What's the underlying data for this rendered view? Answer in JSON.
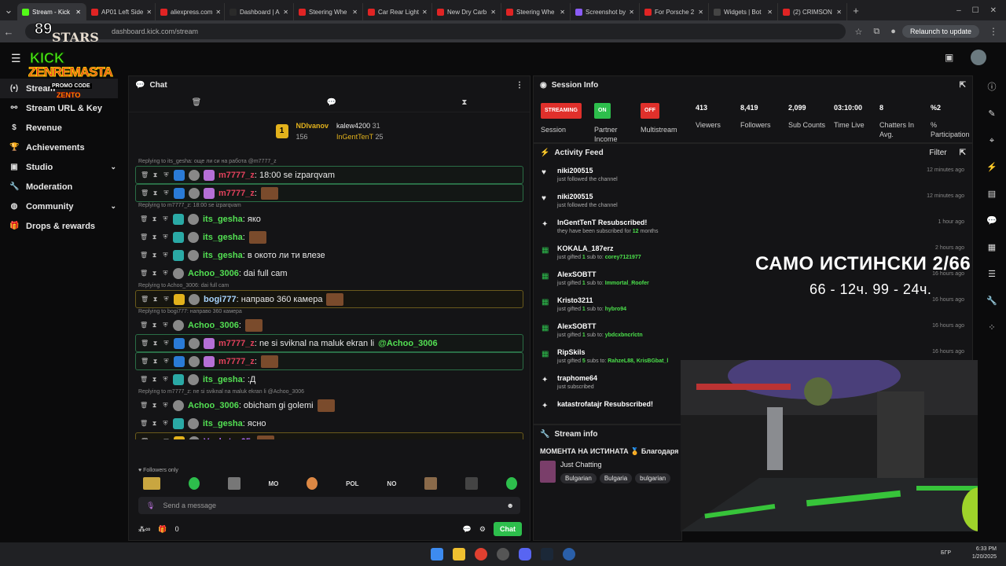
{
  "browser": {
    "tabs": [
      {
        "label": "Stream - Kick",
        "color": "#53fc18",
        "active": true
      },
      {
        "label": "AP01 Left Side",
        "color": "#e02424"
      },
      {
        "label": "aliexpress.com",
        "color": "#e02424"
      },
      {
        "label": "Dashboard | A",
        "color": "#2a2a2a"
      },
      {
        "label": "Steering Whe",
        "color": "#e02424"
      },
      {
        "label": "Car Rear Light",
        "color": "#e02424"
      },
      {
        "label": "New Dry Carb",
        "color": "#e02424"
      },
      {
        "label": "Steering Whe",
        "color": "#e02424"
      },
      {
        "label": "Screenshot by",
        "color": "#8a5cf6"
      },
      {
        "label": "For Porsche 2",
        "color": "#e02424"
      },
      {
        "label": "Widgets | Bot",
        "color": "#444"
      },
      {
        "label": "(2) CRIMSON",
        "color": "#e02424"
      }
    ],
    "url": "dashboard.kick.com/stream",
    "relaunch_label": "Relaunch to update"
  },
  "logo": {
    "line1": "89",
    "line2": "STARS",
    "kick": "KICK",
    "brand": "ZENREMASTA",
    "promo": "PROMO CODE",
    "code": "ZENTO"
  },
  "sidebar": {
    "items": [
      {
        "label": "Stream",
        "icon": "broadcast-icon",
        "glyph": "(•)",
        "active": true
      },
      {
        "label": "Stream URL & Key",
        "icon": "link-icon",
        "glyph": "⚯"
      },
      {
        "label": "Revenue",
        "icon": "dollar-icon",
        "glyph": "$"
      },
      {
        "label": "Achievements",
        "icon": "trophy-icon",
        "glyph": "🏆"
      },
      {
        "label": "Studio",
        "icon": "studio-icon",
        "glyph": "▣",
        "chevron": true
      },
      {
        "label": "Moderation",
        "icon": "wrench-icon",
        "glyph": "🔧"
      },
      {
        "label": "Community",
        "icon": "globe-icon",
        "glyph": "◍",
        "chevron": true
      },
      {
        "label": "Drops & rewards",
        "icon": "gift-icon",
        "glyph": "🎁"
      }
    ]
  },
  "chat": {
    "title": "Chat",
    "pinned": {
      "user1": "NDIvanov",
      "count1": "156",
      "user2": "kalew4200",
      "count2": "31",
      "user3": "InGentTenT",
      "count3": "25"
    },
    "messages": [
      {
        "reply": "Replying to its_gesha: още ли си на работа @m7777_z",
        "user": "m7777_z",
        "color": "#e0415c",
        "text": ": 18:00 se izparqvam",
        "style": "hl",
        "badges": [
          "b-blue",
          "b-avatar",
          "b-purple"
        ]
      },
      {
        "user": "m7777_z",
        "color": "#e0415c",
        "text": ":",
        "style": "hl",
        "badges": [
          "b-blue",
          "b-avatar",
          "b-purple"
        ],
        "emote": true
      },
      {
        "reply": "Replying to m7777_z: 18:00 se izparqvam",
        "user": "its_gesha",
        "color": "#53e053",
        "text": ": яко",
        "badges": [
          "b-teal",
          "b-avatar"
        ]
      },
      {
        "user": "its_gesha",
        "color": "#53e053",
        "text": ":",
        "badges": [
          "b-teal",
          "b-avatar"
        ],
        "emote": true
      },
      {
        "user": "its_gesha",
        "color": "#53e053",
        "text": ": в окото ли ти влезе",
        "badges": [
          "b-teal",
          "b-avatar"
        ]
      },
      {
        "user": "Achoo_3006",
        "color": "#53e053",
        "text": ": dai full cam",
        "badges": [
          "b-avatar"
        ]
      },
      {
        "reply": "Replying to Achoo_3006: dai full cam",
        "user": "bogi777",
        "color": "#a8d4ff",
        "text": ": направо 360 камера",
        "style": "gold",
        "badges": [
          "b-gold",
          "b-avatar"
        ],
        "emote": true
      },
      {
        "reply": "Replying to bogi777: направо 360 камера",
        "user": "Achoo_3006",
        "color": "#53e053",
        "text": ":",
        "badges": [
          "b-avatar"
        ],
        "emote": true
      },
      {
        "user": "m7777_z",
        "color": "#e0415c",
        "text": ": ne si sviknal na maluk ekran li",
        "mention": "@Achoo_3006",
        "style": "hl",
        "badges": [
          "b-blue",
          "b-avatar",
          "b-purple"
        ]
      },
      {
        "user": "m7777_z",
        "color": "#e0415c",
        "text": ":",
        "style": "hl",
        "badges": [
          "b-blue",
          "b-avatar",
          "b-purple"
        ],
        "emote": true
      },
      {
        "user": "its_gesha",
        "color": "#53e053",
        "text": ": :Д",
        "badges": [
          "b-teal",
          "b-avatar"
        ]
      },
      {
        "reply": "Replying to m7777_z: ne si sviknal na maluk ekran li @Achoo_3006",
        "user": "Achoo_3006",
        "color": "#53e053",
        "text": ": obicham gi golemi",
        "badges": [
          "b-avatar"
        ],
        "emote": true
      },
      {
        "user": "its_gesha",
        "color": "#53e053",
        "text": ": ясно",
        "badges": [
          "b-teal",
          "b-avatar"
        ]
      },
      {
        "user": "Vankata_05",
        "color": "#b56fff",
        "text": ":",
        "style": "gold",
        "badges": [
          "b-gold",
          "b-avatar"
        ],
        "emote": true
      }
    ],
    "followers_only": "Followers only",
    "emote_bar": [
      "MO",
      "POL",
      "NO"
    ],
    "input_placeholder": "Send a message",
    "footer_count": "0",
    "send_label": "Chat"
  },
  "session": {
    "title": "Session Info",
    "streaming": "STREAMING",
    "session_label": "Session",
    "partner_state": "ON",
    "partner_label": "Partner Income",
    "multistream_state": "OFF",
    "multistream_label": "Multistream",
    "stats": [
      {
        "value": "413",
        "label": "Viewers"
      },
      {
        "value": "8,419",
        "label": "Followers"
      },
      {
        "value": "2,099",
        "label": "Sub Counts"
      },
      {
        "value": "03:10:00",
        "label": "Time Live"
      },
      {
        "value": "8",
        "label": "Chatters In Avg."
      },
      {
        "value": "%2",
        "label": "% Participation"
      }
    ]
  },
  "activity": {
    "title": "Activity Feed",
    "filter": "Filter",
    "items": [
      {
        "icon": "heart-icon",
        "glyph": "♥",
        "name": "niki200515",
        "desc": "just followed the channel",
        "time": "12 minutes ago"
      },
      {
        "icon": "heart-icon",
        "glyph": "♥",
        "name": "niki200515",
        "desc": "just followed the channel",
        "time": "12 minutes ago"
      },
      {
        "icon": "star-icon",
        "glyph": "✦",
        "name": "InGentTenT Resubscribed!",
        "desc": "they have been subscribed for",
        "desc2": "12",
        "desc3": "months",
        "time": "1 hour ago"
      },
      {
        "icon": "gift-icon",
        "glyph": "▦",
        "name": "KOKALA_187erz",
        "desc": "just gifted",
        "desc2": "1",
        "desc3": "sub to:",
        "target": "corey7121977",
        "time": "2 hours ago"
      },
      {
        "icon": "gift-icon",
        "glyph": "▦",
        "name": "AlexSOBTT",
        "desc": "just gifted",
        "desc2": "1",
        "desc3": "sub to:",
        "target": "Immortal_Roofer",
        "time": "16 hours ago"
      },
      {
        "icon": "gift-icon",
        "glyph": "▦",
        "name": "Kristo3211",
        "desc": "just gifted",
        "desc2": "1",
        "desc3": "sub to:",
        "target": "hybro94",
        "time": "16 hours ago"
      },
      {
        "icon": "gift-icon",
        "glyph": "▦",
        "name": "AlexSOBTT",
        "desc": "just gifted",
        "desc2": "1",
        "desc3": "sub to:",
        "target": "ybdcxbncrlctn",
        "time": "16 hours ago"
      },
      {
        "icon": "gift-icon",
        "glyph": "▦",
        "name": "RipSkils",
        "desc": "just gifted",
        "desc2": "5",
        "desc3": "subs to:",
        "target": "RahzeL88, KrisBGbat_l",
        "time": "16 hours ago"
      },
      {
        "icon": "star-icon",
        "glyph": "✦",
        "name": "traphome64",
        "desc": "just subscribed",
        "time": ""
      },
      {
        "icon": "star-icon",
        "glyph": "✦",
        "name": "katastrofatajr Resubscribed!",
        "desc": "",
        "time": ""
      }
    ]
  },
  "stream_info": {
    "title": "Stream info",
    "stream_title": "МОМЕНТА НА ИСТИНАТА 🏅 Благодаря",
    "category": "Just Chatting",
    "tags": [
      "Bulgarian",
      "Bulgaria",
      "bulgarian"
    ]
  },
  "overlay": {
    "line1": "САМО ИСТИНСКИ 2/66",
    "line2": "66 - 12ч.  99 - 24ч."
  },
  "taskbar": {
    "time": "6:33 PM",
    "date": "1/20/2025",
    "lang": "БГР"
  }
}
